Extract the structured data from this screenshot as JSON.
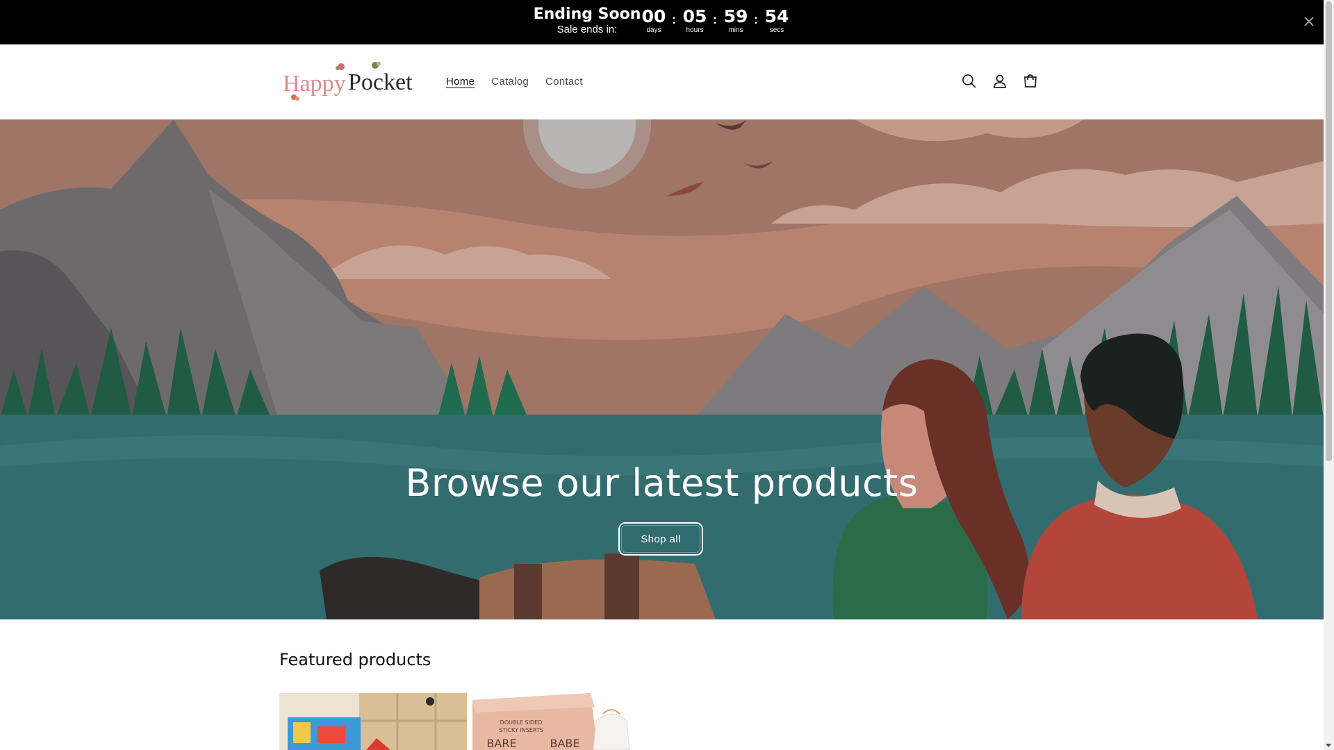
{
  "announcement": {
    "title": "Ending Soon",
    "subtitle": "Sale ends in:",
    "countdown": [
      {
        "value": "00",
        "unit": "days"
      },
      {
        "value": "05",
        "unit": "hours"
      },
      {
        "value": "59",
        "unit": "mins"
      },
      {
        "value": "54",
        "unit": "secs"
      }
    ],
    "separator": ":"
  },
  "header": {
    "logo_text_1": "Happy",
    "logo_text_2": "Pocket",
    "nav": [
      {
        "label": "Home",
        "active": true
      },
      {
        "label": "Catalog"
      },
      {
        "label": "Contact"
      }
    ],
    "icons": [
      "search-icon",
      "account-icon",
      "cart-icon"
    ]
  },
  "hero": {
    "title": "Browse our latest products",
    "button": "Shop all"
  },
  "featured": {
    "title": "Featured products",
    "product2_box_line1": "DOUBLE SIDED",
    "product2_box_line2": "STICKY INSERTS",
    "product2_brand_left": "BARE",
    "product2_brand_right": "BABE"
  }
}
